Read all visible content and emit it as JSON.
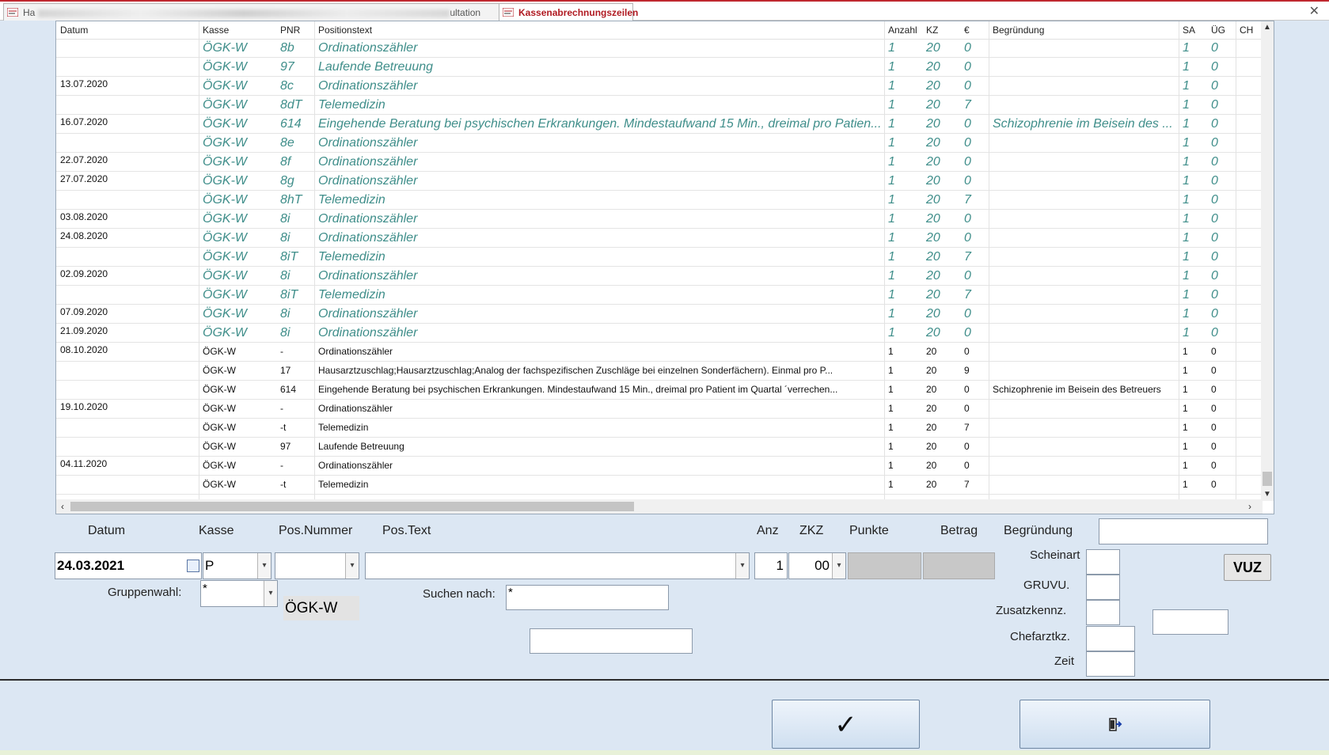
{
  "tabs": [
    {
      "label": "Ha",
      "label_tail": "ultation",
      "active": false
    },
    {
      "label": "Kassenabrechnungszeilen",
      "active": true
    }
  ],
  "grid": {
    "headers": [
      "Datum",
      "Kasse",
      "PNR",
      "Positionstext",
      "Anzahl",
      "KZ",
      "€",
      "Begründung",
      "SA",
      "ÜG",
      "CH"
    ],
    "rows": [
      {
        "italic": true,
        "datum": "",
        "kasse": "ÖGK-W",
        "pnr": "8b",
        "text": "Ordinationszähler",
        "anzahl": "1",
        "kz": "20",
        "eur": "0",
        "begr": "",
        "sa": "1",
        "ug": "0"
      },
      {
        "italic": true,
        "datum": "",
        "kasse": "ÖGK-W",
        "pnr": "97",
        "text": "Laufende Betreuung",
        "anzahl": "1",
        "kz": "20",
        "eur": "0",
        "begr": "",
        "sa": "1",
        "ug": "0"
      },
      {
        "italic": true,
        "datum": "13.07.2020",
        "kasse": "ÖGK-W",
        "pnr": "8c",
        "text": "Ordinationszähler",
        "anzahl": "1",
        "kz": "20",
        "eur": "0",
        "begr": "",
        "sa": "1",
        "ug": "0"
      },
      {
        "italic": true,
        "datum": "",
        "kasse": "ÖGK-W",
        "pnr": "8dT",
        "text": "Telemedizin",
        "anzahl": "1",
        "kz": "20",
        "eur": "7",
        "begr": "",
        "sa": "1",
        "ug": "0"
      },
      {
        "italic": true,
        "datum": "16.07.2020",
        "kasse": "ÖGK-W",
        "pnr": "614",
        "text": "Eingehende Beratung bei psychischen Erkrankungen. Mindestaufwand 15 Min., dreimal pro Patien...",
        "anzahl": "1",
        "kz": "20",
        "eur": "0",
        "begr": "Schizophrenie im Beisein des ...",
        "sa": "1",
        "ug": "0"
      },
      {
        "italic": true,
        "datum": "",
        "kasse": "ÖGK-W",
        "pnr": "8e",
        "text": "Ordinationszähler",
        "anzahl": "1",
        "kz": "20",
        "eur": "0",
        "begr": "",
        "sa": "1",
        "ug": "0"
      },
      {
        "italic": true,
        "datum": "22.07.2020",
        "kasse": "ÖGK-W",
        "pnr": "8f",
        "text": "Ordinationszähler",
        "anzahl": "1",
        "kz": "20",
        "eur": "0",
        "begr": "",
        "sa": "1",
        "ug": "0"
      },
      {
        "italic": true,
        "datum": "27.07.2020",
        "kasse": "ÖGK-W",
        "pnr": "8g",
        "text": "Ordinationszähler",
        "anzahl": "1",
        "kz": "20",
        "eur": "0",
        "begr": "",
        "sa": "1",
        "ug": "0"
      },
      {
        "italic": true,
        "datum": "",
        "kasse": "ÖGK-W",
        "pnr": "8hT",
        "text": "Telemedizin",
        "anzahl": "1",
        "kz": "20",
        "eur": "7",
        "begr": "",
        "sa": "1",
        "ug": "0"
      },
      {
        "italic": true,
        "datum": "03.08.2020",
        "kasse": "ÖGK-W",
        "pnr": "8i",
        "text": "Ordinationszähler",
        "anzahl": "1",
        "kz": "20",
        "eur": "0",
        "begr": "",
        "sa": "1",
        "ug": "0"
      },
      {
        "italic": true,
        "datum": "24.08.2020",
        "kasse": "ÖGK-W",
        "pnr": "8i",
        "text": "Ordinationszähler",
        "anzahl": "1",
        "kz": "20",
        "eur": "0",
        "begr": "",
        "sa": "1",
        "ug": "0"
      },
      {
        "italic": true,
        "datum": "",
        "kasse": "ÖGK-W",
        "pnr": "8iT",
        "text": "Telemedizin",
        "anzahl": "1",
        "kz": "20",
        "eur": "7",
        "begr": "",
        "sa": "1",
        "ug": "0"
      },
      {
        "italic": true,
        "datum": "02.09.2020",
        "kasse": "ÖGK-W",
        "pnr": "8i",
        "text": "Ordinationszähler",
        "anzahl": "1",
        "kz": "20",
        "eur": "0",
        "begr": "",
        "sa": "1",
        "ug": "0"
      },
      {
        "italic": true,
        "datum": "",
        "kasse": "ÖGK-W",
        "pnr": "8iT",
        "text": "Telemedizin",
        "anzahl": "1",
        "kz": "20",
        "eur": "7",
        "begr": "",
        "sa": "1",
        "ug": "0"
      },
      {
        "italic": true,
        "datum": "07.09.2020",
        "kasse": "ÖGK-W",
        "pnr": "8i",
        "text": "Ordinationszähler",
        "anzahl": "1",
        "kz": "20",
        "eur": "0",
        "begr": "",
        "sa": "1",
        "ug": "0"
      },
      {
        "italic": true,
        "datum": "21.09.2020",
        "kasse": "ÖGK-W",
        "pnr": "8i",
        "text": "Ordinationszähler",
        "anzahl": "1",
        "kz": "20",
        "eur": "0",
        "begr": "",
        "sa": "1",
        "ug": "0"
      },
      {
        "italic": false,
        "datum": "08.10.2020",
        "kasse": "ÖGK-W",
        "pnr": "-",
        "text": "Ordinationszähler",
        "anzahl": "1",
        "kz": "20",
        "eur": "0",
        "begr": "",
        "sa": "1",
        "ug": "0"
      },
      {
        "italic": false,
        "datum": "",
        "kasse": "ÖGK-W",
        "pnr": "17",
        "text": "Hausarztzuschlag;Hausarztzuschlag;Analog der fachspezifischen Zuschläge bei einzelnen Sonderfächern). Einmal pro P...",
        "anzahl": "1",
        "kz": "20",
        "eur": "9",
        "begr": "",
        "sa": "1",
        "ug": "0"
      },
      {
        "italic": false,
        "datum": "",
        "kasse": "ÖGK-W",
        "pnr": "614",
        "text": "Eingehende Beratung bei psychischen Erkrankungen. Mindestaufwand 15 Min., dreimal pro Patient im Quartal ´verrechen...",
        "anzahl": "1",
        "kz": "20",
        "eur": "0",
        "begr": "Schizophrenie im Beisein des Betreuers",
        "sa": "1",
        "ug": "0"
      },
      {
        "italic": false,
        "datum": "19.10.2020",
        "kasse": "ÖGK-W",
        "pnr": "-",
        "text": "Ordinationszähler",
        "anzahl": "1",
        "kz": "20",
        "eur": "0",
        "begr": "",
        "sa": "1",
        "ug": "0"
      },
      {
        "italic": false,
        "datum": "",
        "kasse": "ÖGK-W",
        "pnr": "-t",
        "text": "Telemedizin",
        "anzahl": "1",
        "kz": "20",
        "eur": "7",
        "begr": "",
        "sa": "1",
        "ug": "0"
      },
      {
        "italic": false,
        "datum": "",
        "kasse": "ÖGK-W",
        "pnr": "97",
        "text": "Laufende Betreuung",
        "anzahl": "1",
        "kz": "20",
        "eur": "0",
        "begr": "",
        "sa": "1",
        "ug": "0"
      },
      {
        "italic": false,
        "datum": "04.11.2020",
        "kasse": "ÖGK-W",
        "pnr": "-",
        "text": "Ordinationszähler",
        "anzahl": "1",
        "kz": "20",
        "eur": "0",
        "begr": "",
        "sa": "1",
        "ug": "0"
      },
      {
        "italic": false,
        "datum": "",
        "kasse": "ÖGK-W",
        "pnr": "-t",
        "text": "Telemedizin",
        "anzahl": "1",
        "kz": "20",
        "eur": "7",
        "begr": "",
        "sa": "1",
        "ug": "0"
      }
    ]
  },
  "form": {
    "labels": {
      "datum": "Datum",
      "kasse": "Kasse",
      "pos_nummer": "Pos.Nummer",
      "pos_text": "Pos.Text",
      "anz": "Anz",
      "zkz": "ZKZ",
      "punkte": "Punkte",
      "betrag": "Betrag",
      "begruendung": "Begründung",
      "gruppenwahl": "Gruppenwahl:",
      "suchen_nach": "Suchen nach:",
      "scheinart": "Scheinart",
      "gruvu": "GRUVU.",
      "zusatzkennz": "Zusatzkennz.",
      "chefarztkz": "Chefarztkz.",
      "zeit": "Zeit"
    },
    "values": {
      "datum": "24.03.2021",
      "kasse": "P",
      "pos_nummer": "",
      "pos_text": "",
      "anz": "1",
      "zkz": "00",
      "gruppenwahl": "*",
      "kasse_name": "ÖGK-W",
      "suchen_nach": "*"
    },
    "vuz_button": "VUZ",
    "ok_symbol": "✓"
  },
  "colors": {
    "accent": "#b01a22",
    "italic_row": "#3f8e8a",
    "background": "#dce7f3"
  }
}
